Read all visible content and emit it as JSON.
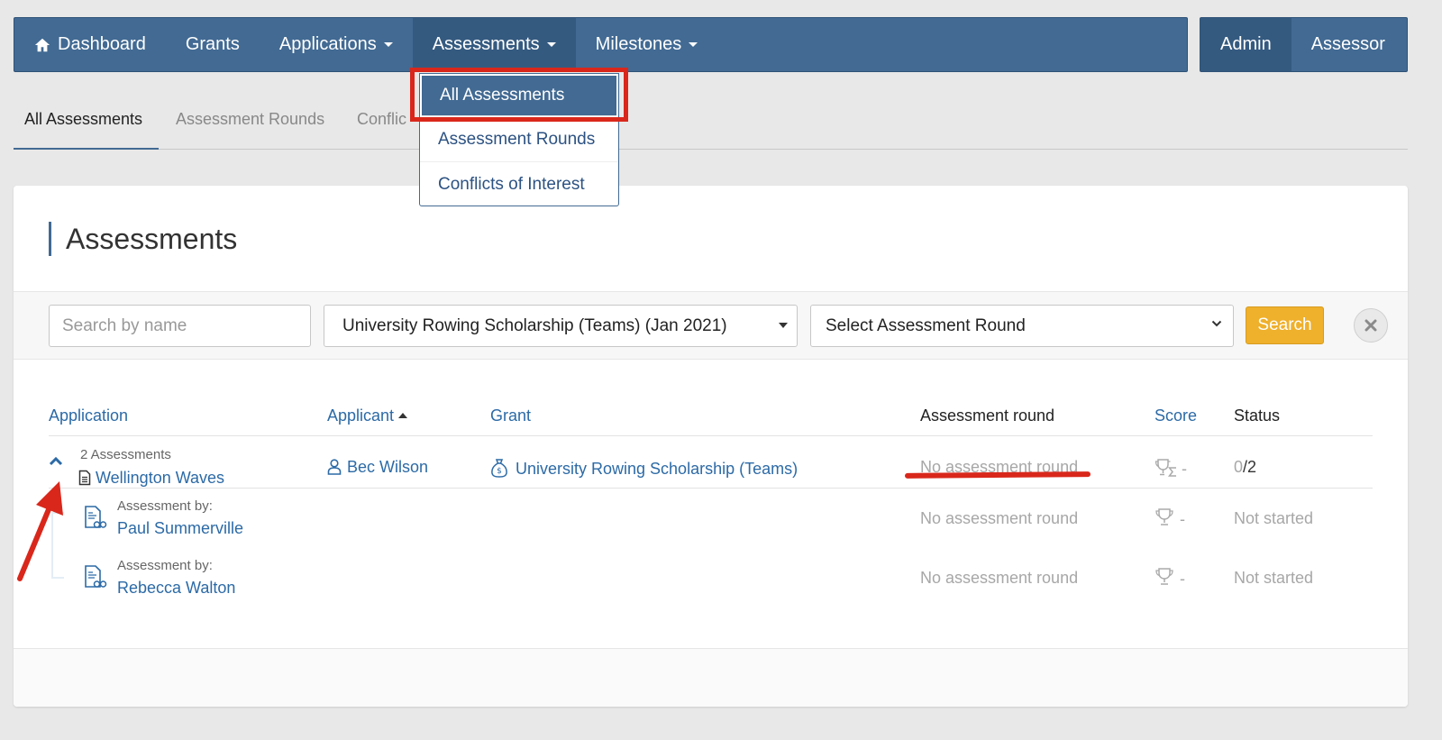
{
  "nav": {
    "items": [
      {
        "label": "Dashboard",
        "has_caret": false,
        "icon": "home-icon"
      },
      {
        "label": "Grants",
        "has_caret": false
      },
      {
        "label": "Applications",
        "has_caret": true
      },
      {
        "label": "Assessments",
        "has_caret": true,
        "active": true
      },
      {
        "label": "Milestones",
        "has_caret": true
      }
    ],
    "roles": [
      {
        "label": "Admin",
        "active": true
      },
      {
        "label": "Assessor",
        "active": false
      }
    ]
  },
  "dropdown": {
    "items": [
      "All Assessments",
      "Assessment Rounds",
      "Conflicts of Interest"
    ],
    "active_index": 0
  },
  "subtabs": [
    "All Assessments",
    "Assessment Rounds",
    "Conflic"
  ],
  "panel": {
    "title": "Assessments"
  },
  "filters": {
    "search_placeholder": "Search by name",
    "grant_selected": "University Rowing Scholarship (Teams) (Jan 2021)",
    "round_selected": "Select Assessment Round",
    "search_button": "Search"
  },
  "table": {
    "headers": {
      "application": "Application",
      "applicant": "Applicant",
      "grant": "Grant",
      "round": "Assessment round",
      "score": "Score",
      "status": "Status"
    },
    "application_row": {
      "assessment_count": "2 Assessments",
      "application": "Wellington Waves",
      "applicant": "Bec Wilson",
      "grant": "University Rowing Scholarship (Teams)",
      "round": "No assessment round",
      "score": "-",
      "status_done": "0",
      "status_total": "/2"
    },
    "assessments": [
      {
        "label": "Assessment by:",
        "assessor": "Paul Summerville",
        "round": "No assessment round",
        "score": "-",
        "status": "Not started"
      },
      {
        "label": "Assessment by:",
        "assessor": "Rebecca Walton",
        "round": "No assessment round",
        "score": "-",
        "status": "Not started"
      }
    ]
  },
  "colors": {
    "nav_bg": "#426a93",
    "nav_active": "#355a80",
    "link": "#2c6aa6",
    "search_button": "#efb02c",
    "annotation_red": "#d9271b"
  }
}
